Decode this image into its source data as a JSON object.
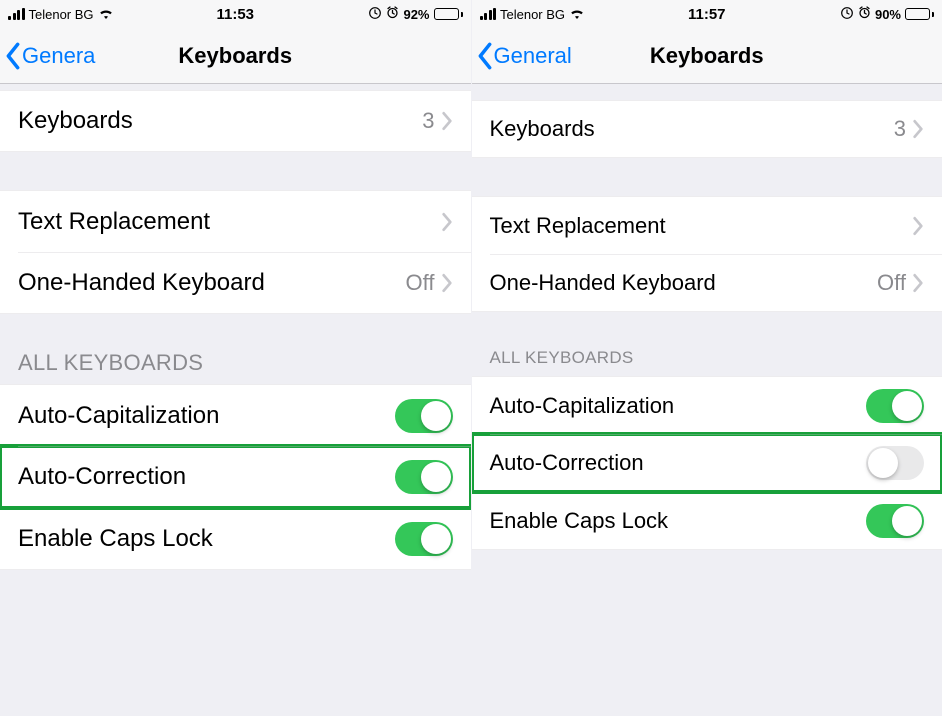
{
  "left": {
    "status": {
      "carrier": "Telenor BG",
      "time": "11:53",
      "battery_pct": "92%",
      "battery_fill": 92
    },
    "nav": {
      "back": "Genera",
      "title": "Keyboards"
    },
    "g1": {
      "keyboards_label": "Keyboards",
      "keyboards_count": "3"
    },
    "g2": {
      "text_replacement": "Text Replacement",
      "one_handed": "One-Handed Keyboard",
      "one_handed_value": "Off"
    },
    "section": "ALL KEYBOARDS",
    "toggles": {
      "auto_cap": {
        "label": "Auto-Capitalization",
        "on": true
      },
      "auto_corr": {
        "label": "Auto-Correction",
        "on": true
      },
      "caps_lock": {
        "label": "Enable Caps Lock",
        "on": true
      }
    }
  },
  "right": {
    "status": {
      "carrier": "Telenor BG",
      "time": "11:57",
      "battery_pct": "90%",
      "battery_fill": 90
    },
    "nav": {
      "back": "General",
      "title": "Keyboards"
    },
    "g1": {
      "keyboards_label": "Keyboards",
      "keyboards_count": "3"
    },
    "g2": {
      "text_replacement": "Text Replacement",
      "one_handed": "One-Handed Keyboard",
      "one_handed_value": "Off"
    },
    "section": "ALL KEYBOARDS",
    "toggles": {
      "auto_cap": {
        "label": "Auto-Capitalization",
        "on": true
      },
      "auto_corr": {
        "label": "Auto-Correction",
        "on": false
      },
      "caps_lock": {
        "label": "Enable Caps Lock",
        "on": true
      }
    }
  }
}
